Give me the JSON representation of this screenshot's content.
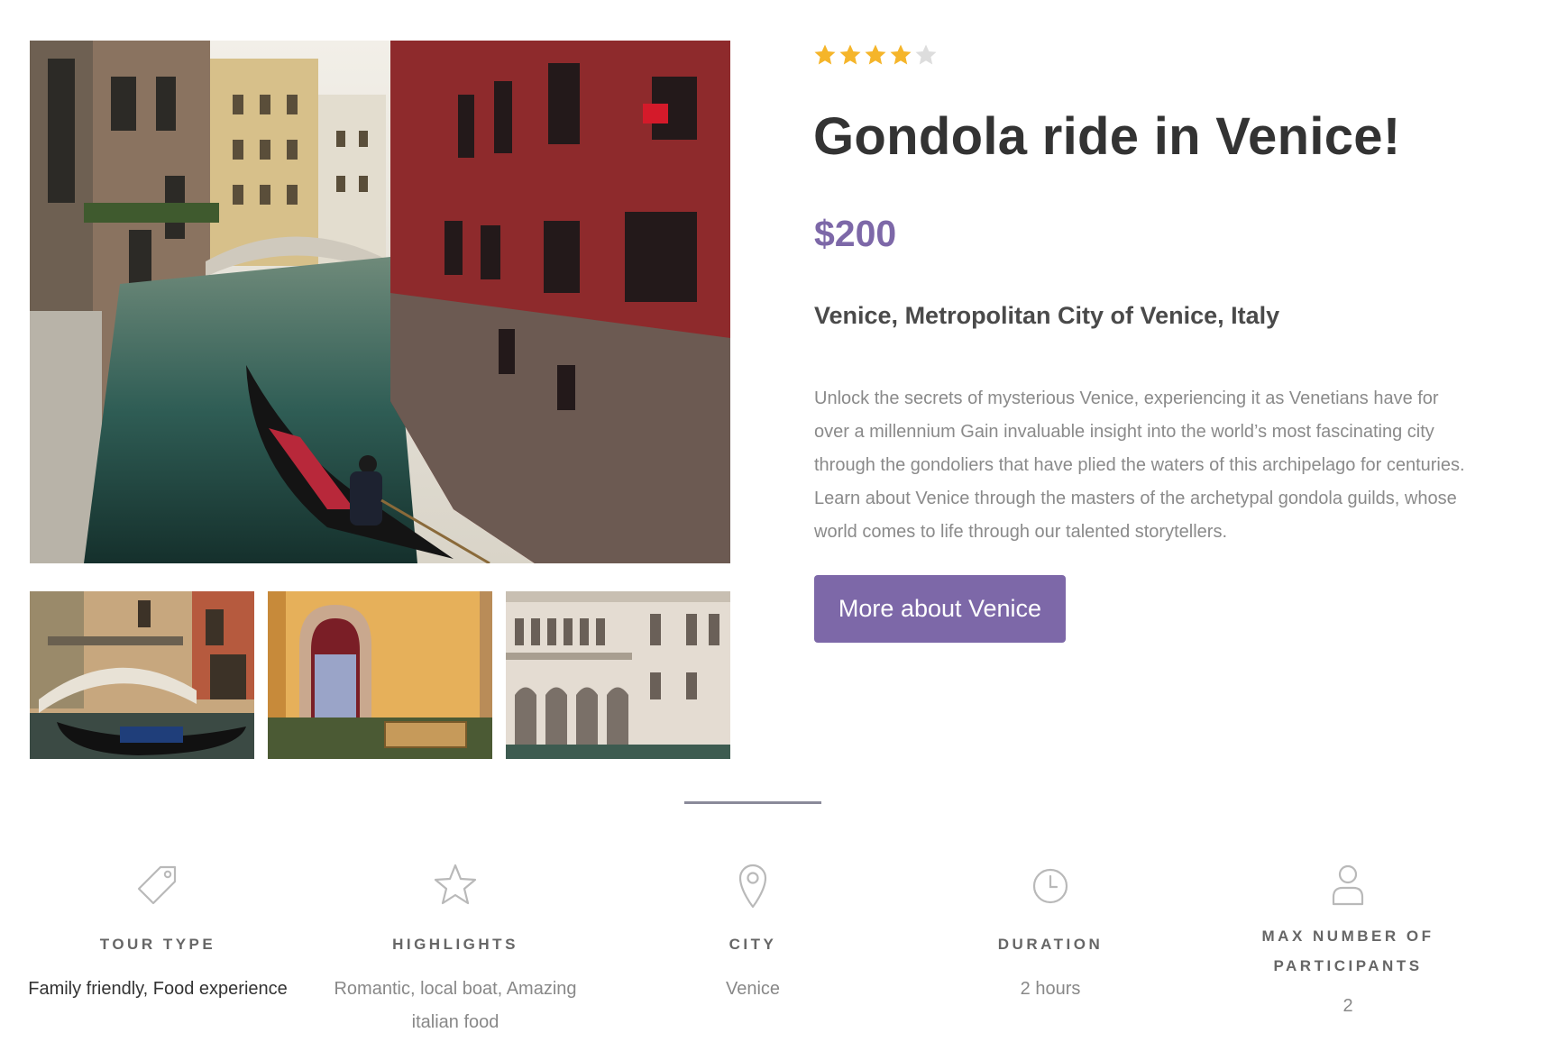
{
  "tour": {
    "rating": 4,
    "rating_max": 5,
    "title": "Gondola ride in Venice!",
    "price": "$200",
    "location": "Venice, Metropolitan City of Venice, Italy",
    "description": "Unlock the secrets of mysterious Venice, experiencing it as Venetians have for over a millennium Gain invaluable insight into the world’s most fascinating city through the gondoliers that have plied the waters of this archipelago for centuries. Learn about Venice through the masters of the archetypal gondola guilds, whose world comes to life through our talented storytellers.",
    "cta_label": "More about Venice"
  },
  "colors": {
    "accent": "#7d68a8",
    "star_filled": "#f5b52a",
    "star_empty": "#dddddd",
    "icon_stroke": "#b9b9b9"
  },
  "details": [
    {
      "icon": "tag-icon",
      "label": "TOUR TYPE",
      "value": "Family friendly, Food experience"
    },
    {
      "icon": "star-icon",
      "label": "HIGHLIGHTS",
      "value": "Romantic, local boat, Amazing italian food"
    },
    {
      "icon": "map-pin-icon",
      "label": "CITY",
      "value": "Venice"
    },
    {
      "icon": "clock-icon",
      "label": "DURATION",
      "value": "2 hours"
    },
    {
      "icon": "user-icon",
      "label": "MAX NUMBER OF PARTICIPANTS",
      "value": "2"
    }
  ]
}
